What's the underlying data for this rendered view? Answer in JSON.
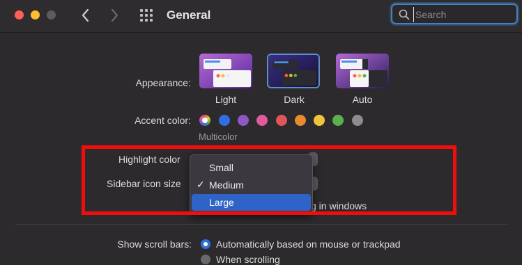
{
  "window": {
    "title": "General"
  },
  "search": {
    "placeholder": "Search",
    "icon": "magnifier-icon"
  },
  "appearance": {
    "label": "Appearance:",
    "options": [
      {
        "label": "Light",
        "selected": false
      },
      {
        "label": "Dark",
        "selected": true
      },
      {
        "label": "Auto",
        "selected": false
      }
    ]
  },
  "accent": {
    "label": "Accent color:",
    "selected_name": "Multicolor",
    "colors": [
      "#2f6fe0",
      "#8e57c5",
      "#e05a9c",
      "#e0555a",
      "#e88a2f",
      "#f0c33c",
      "#5bb04d",
      "#8e8c90"
    ]
  },
  "highlight": {
    "label": "Highlight color"
  },
  "sidebar_icon": {
    "label": "Sidebar icon size"
  },
  "size_menu": {
    "items": [
      {
        "label": "Small",
        "checked": false,
        "highlighted": false
      },
      {
        "label": "Medium",
        "checked": true,
        "highlighted": false
      },
      {
        "label": "Large",
        "checked": false,
        "highlighted": true
      }
    ],
    "checkmark": "✓"
  },
  "wallpaper_tinting": {
    "partial_label": "g in windows"
  },
  "scroll_bars": {
    "label": "Show scroll bars:",
    "options": [
      {
        "label": "Automatically based on mouse or trackpad",
        "selected": true
      },
      {
        "label": "When scrolling",
        "selected": false
      }
    ]
  },
  "colors": {
    "annotation_red": "#f20d0d",
    "menu_selection": "#2f63c7",
    "focus_ring": "#4b7fb5"
  }
}
